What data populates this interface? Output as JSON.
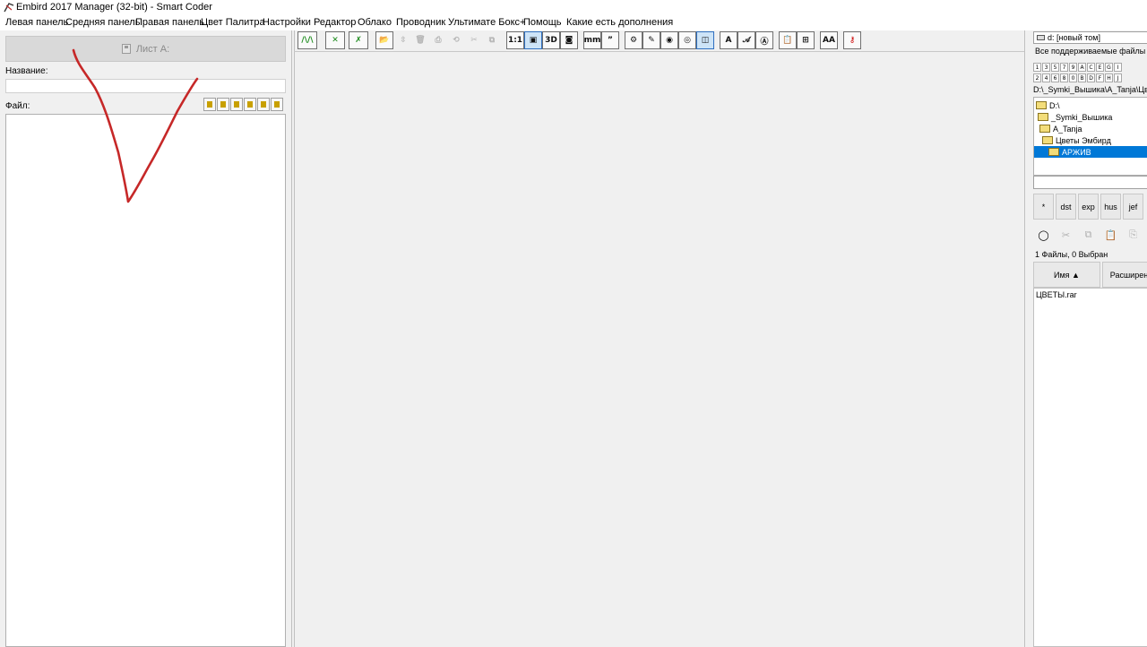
{
  "window": {
    "title": "Embird 2017 Manager (32-bit) - Smart Coder"
  },
  "menu": [
    "Левая панель",
    "Средняя панель",
    "Правая панель",
    "Цвет Палитра",
    "Настройки",
    "Редактор",
    "Облако",
    "Проводник",
    "Ультимате Бокс+",
    "Помощь",
    "Какие есть дополнения"
  ],
  "left_panel": {
    "sheet_button_label": "Лист А:",
    "name_label": "Название:",
    "name_value": "",
    "file_label": "Файл:"
  },
  "toolbar": {
    "zoom_1_1": "1:1",
    "view_3d": "3D",
    "units_mm": "mm",
    "font_a": "A",
    "font_aa": "AA"
  },
  "right_panel": {
    "drive": "d: [новый том]",
    "filter": "Все поддерживаемые файлы",
    "letters_row1": [
      "1",
      "3",
      "5",
      "7",
      "9",
      "A",
      "C",
      "E",
      "G",
      "I"
    ],
    "letters_row2": [
      "2",
      "4",
      "6",
      "8",
      "0",
      "B",
      "D",
      "F",
      "H",
      "J"
    ],
    "path": "D:\\_Symki_Вышика\\A_Tanja\\Цветы",
    "tree": [
      {
        "label": "D:\\",
        "selected": false
      },
      {
        "label": "_Symki_Вышика",
        "selected": false
      },
      {
        "label": "A_Tanja",
        "selected": false
      },
      {
        "label": "Цветы Эмбирд",
        "selected": false
      },
      {
        "label": "АРЖИВ",
        "selected": true
      }
    ],
    "search_value": "",
    "ext_buttons": [
      "*",
      "dst",
      "exp",
      "hus",
      "jef"
    ],
    "file_count": "1 Файлы, 0 Выбран",
    "columns": [
      "Имя ▲",
      "Расширение"
    ],
    "files": [
      "ЦВЕТЫ.rar"
    ]
  },
  "colors": {
    "selection": "#0078d7",
    "annotation_stroke": "#c62828",
    "panel_bg": "#f0f0f0"
  }
}
